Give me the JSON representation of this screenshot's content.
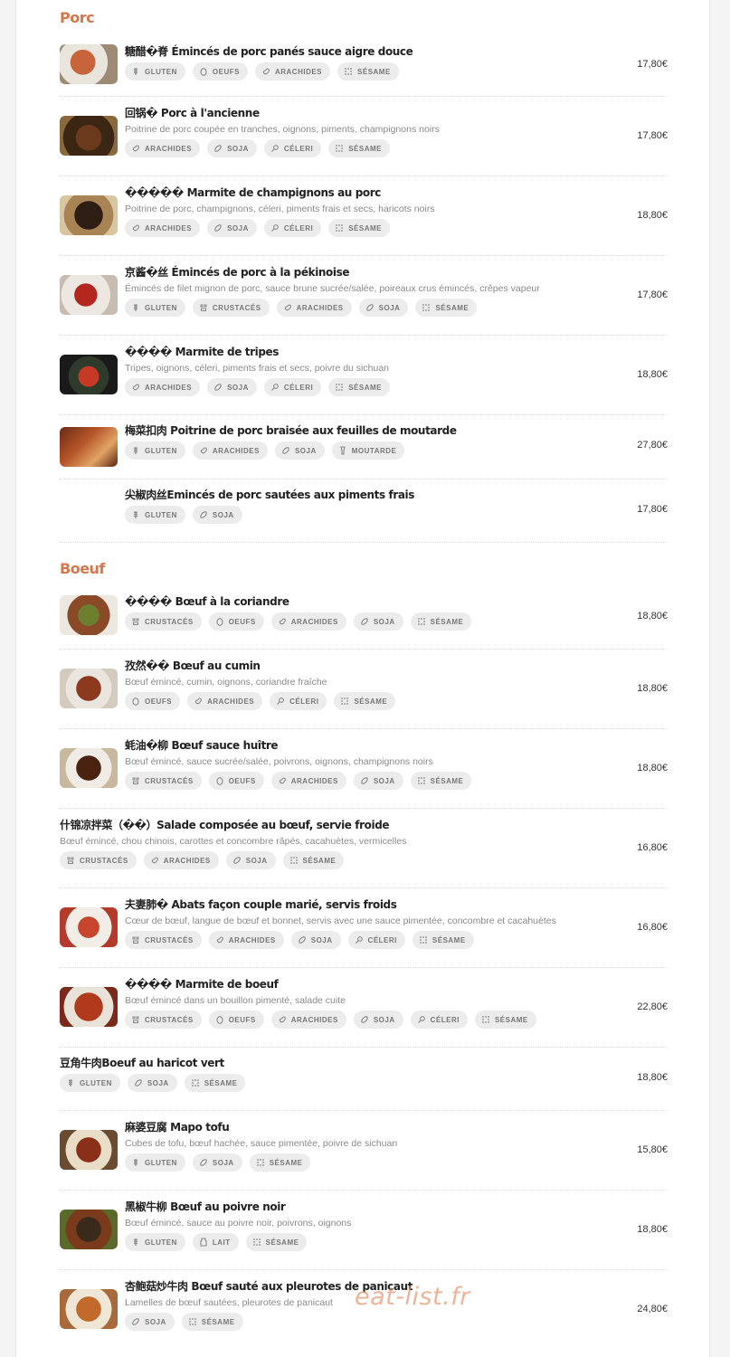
{
  "sections": [
    {
      "title": "Porc",
      "items": [
        {
          "name": "糖醋�脊 Émincés de porc panés sauce aigre douce",
          "desc": "",
          "price": "17,80€",
          "photo": "food-photo",
          "allergens": [
            "GLUTEN",
            "OEUFS",
            "ARACHIDES",
            "SÉSAME"
          ]
        },
        {
          "name": "回锅� Porc à l'ancienne",
          "desc": "Poitrine de porc coupée en tranches, oignons, piments, champignons noirs",
          "price": "17,80€",
          "photo": "food-photo",
          "allergens": [
            "ARACHIDES",
            "SOJA",
            "CÉLERI",
            "SÉSAME"
          ]
        },
        {
          "name": "����� Marmite de champignons au porc",
          "desc": "Poitrine de porc, champignons, céleri, piments frais et secs, haricots noirs",
          "price": "18,80€",
          "photo": "food-photo",
          "allergens": [
            "ARACHIDES",
            "SOJA",
            "CÉLERI",
            "SÉSAME"
          ]
        },
        {
          "name": "京酱�丝 Émincés de porc à la pékinoise",
          "desc": "Émincés de filet mignon de porc, sauce brune sucrée/salée, poireaux crus émincés, crêpes vapeur",
          "price": "17,80€",
          "photo": "food-photo",
          "allergens": [
            "GLUTEN",
            "CRUSTACÉS",
            "ARACHIDES",
            "SOJA",
            "SÉSAME"
          ]
        },
        {
          "name": "���� Marmite de tripes",
          "desc": "Tripes, oignons, céleri, piments frais et secs, poivre du sichuan",
          "price": "18,80€",
          "photo": "food-photo",
          "allergens": [
            "ARACHIDES",
            "SOJA",
            "CÉLERI",
            "SÉSAME"
          ]
        },
        {
          "name": "梅菜扣肉 Poitrine de porc braisée aux feuilles de moutarde",
          "desc": "",
          "price": "27,80€",
          "photo": "food-photo",
          "allergens": [
            "GLUTEN",
            "ARACHIDES",
            "SOJA",
            "MOUTARDE"
          ]
        },
        {
          "name": "尖椒肉丝Emincés de porc sautées aux piments frais",
          "desc": "",
          "price": "17,80€",
          "photo": "",
          "allergens": [
            "GLUTEN",
            "SOJA"
          ]
        }
      ]
    },
    {
      "title": "Boeuf",
      "items": [
        {
          "name": "���� Bœuf à la coriandre",
          "desc": "",
          "price": "18,80€",
          "photo": "food-photo",
          "allergens": [
            "CRUSTACÉS",
            "OEUFS",
            "ARACHIDES",
            "SOJA",
            "SÉSAME"
          ]
        },
        {
          "name": "孜然�� Bœuf au cumin",
          "desc": "Bœuf émincé, cumin, oignons, coriandre fraîche",
          "price": "18,80€",
          "photo": "food-photo",
          "allergens": [
            "OEUFS",
            "ARACHIDES",
            "CÉLERI",
            "SÉSAME"
          ]
        },
        {
          "name": "蚝油�柳 Bœuf sauce huître",
          "desc": "Bœuf émincé, sauce sucrée/salée, poivrons, oignons, champignons noirs",
          "price": "18,80€",
          "photo": "food-photo",
          "allergens": [
            "CRUSTACÉS",
            "OEUFS",
            "ARACHIDES",
            "SOJA",
            "SÉSAME"
          ]
        },
        {
          "name": "什锦凉拌菜（��）Salade composée au bœuf, servie froide",
          "desc": "Bœuf émincé, chou chinois, carottes et concombre râpés, cacahuètes, vermicelles",
          "price": "16,80€",
          "photo": "",
          "allergens": [
            "CRUSTACÉS",
            "ARACHIDES",
            "SOJA",
            "SÉSAME"
          ]
        },
        {
          "name": "夫妻肺� Abats façon couple marié, servis froids",
          "desc": "Cœur de bœuf, langue de bœuf et bonnet, servis avec une sauce pimentée, concombre et cacahuètes",
          "price": "16,80€",
          "photo": "food-photo",
          "allergens": [
            "CRUSTACÉS",
            "ARACHIDES",
            "SOJA",
            "CÉLERI",
            "SÉSAME"
          ]
        },
        {
          "name": "���� Marmite de boeuf",
          "desc": "Bœuf émincé dans un bouillon pimenté, salade cuite",
          "price": "22,80€",
          "photo": "food-photo",
          "allergens": [
            "CRUSTACÉS",
            "OEUFS",
            "ARACHIDES",
            "SOJA",
            "CÉLERI",
            "SÉSAME"
          ]
        },
        {
          "name": "豆角牛肉Boeuf au haricot vert",
          "desc": "",
          "price": "18,80€",
          "photo": "",
          "allergens": [
            "GLUTEN",
            "SOJA",
            "SÉSAME"
          ]
        },
        {
          "name": "麻婆豆腐 Mapo tofu",
          "desc": "Cubes de tofu, bœuf hachée, sauce pimentée, poivre de sichuan",
          "price": "15,80€",
          "photo": "food-photo",
          "allergens": [
            "GLUTEN",
            "SOJA",
            "SÉSAME"
          ]
        },
        {
          "name": "黑椒牛柳 Bœuf au poivre noir",
          "desc": "Bœuf émincé, sauce au poivre noir, poivrons, oignons",
          "price": "18,80€",
          "photo": "food-photo",
          "allergens": [
            "GLUTEN",
            "LAIT",
            "SÉSAME"
          ]
        },
        {
          "name": "杏鲍菇炒牛肉 Bœuf sauté aux pleurotes de panicaut",
          "desc": "Lamelles de bœuf sautées, pleurotes de panicaut",
          "price": "24,80€",
          "photo": "food-photo",
          "allergens": [
            "SOJA",
            "SÉSAME"
          ]
        }
      ]
    }
  ],
  "watermark": "eat-list.fr",
  "colors": {
    "accent": "#d4774c",
    "tag_bg": "#ececec",
    "tag_text": "#777777"
  },
  "icons": {
    "GLUTEN": "wheat-icon",
    "OEUFS": "egg-icon",
    "ARACHIDES": "peanut-icon",
    "SÉSAME": "sesame-icon",
    "SOJA": "soy-icon",
    "CÉLERI": "celery-icon",
    "CRUSTACÉS": "crustacean-icon",
    "MOUTARDE": "mustard-icon",
    "LAIT": "milk-icon"
  }
}
